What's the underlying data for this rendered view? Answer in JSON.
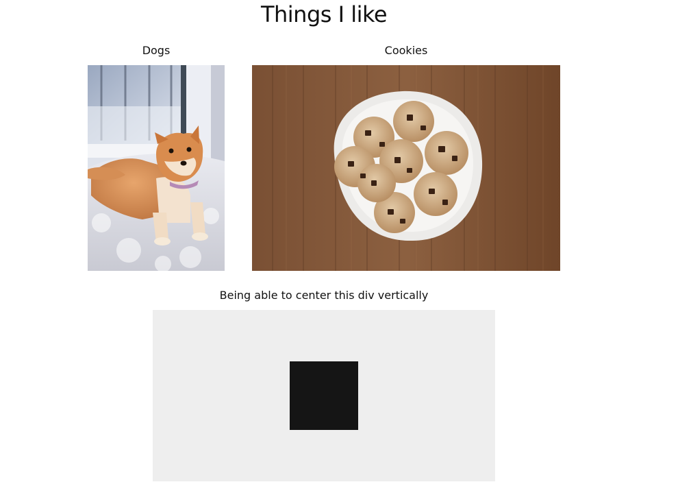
{
  "page": {
    "title": "Things I like"
  },
  "items": [
    {
      "caption": "Dogs",
      "image": "shiba-inu-dog-photo"
    },
    {
      "caption": "Cookies",
      "image": "chocolate-chip-cookies-plate-photo"
    }
  ],
  "centering": {
    "caption": "Being able to center this div vertically"
  },
  "colors": {
    "box_background": "#eeeeee",
    "square": "#151515"
  }
}
